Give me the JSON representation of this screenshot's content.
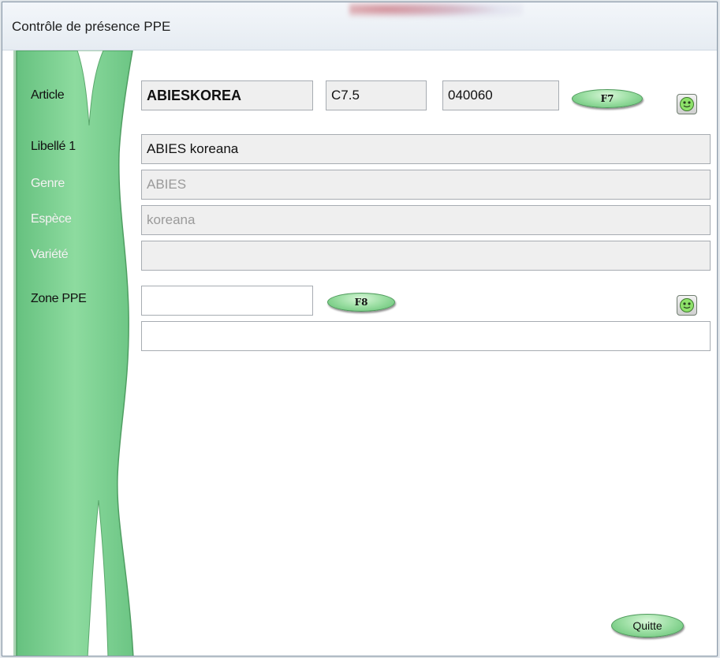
{
  "window": {
    "title": "Contrôle de présence PPE"
  },
  "labels": {
    "article": "Article",
    "libelle1": "Libellé 1",
    "genre": "Genre",
    "espece": "Espèce",
    "variete": "Variété",
    "zone_ppe": "Zone PPE"
  },
  "fields": {
    "article_code": "ABIESKOREA",
    "article_size": "C7.5",
    "article_number": "040060",
    "libelle1": "ABIES koreana",
    "genre": "ABIES",
    "espece": "koreana",
    "variete": "",
    "zone_ppe": "",
    "zone_ppe_description": ""
  },
  "buttons": {
    "f7": "F7",
    "f8": "F8",
    "quitte": "Quitte"
  },
  "icons": {
    "article_status": "smiley-green-icon",
    "zone_status": "smiley-green-icon"
  },
  "colors": {
    "decoration_green": "#7fd394",
    "button_green": "#9fe0a6"
  }
}
